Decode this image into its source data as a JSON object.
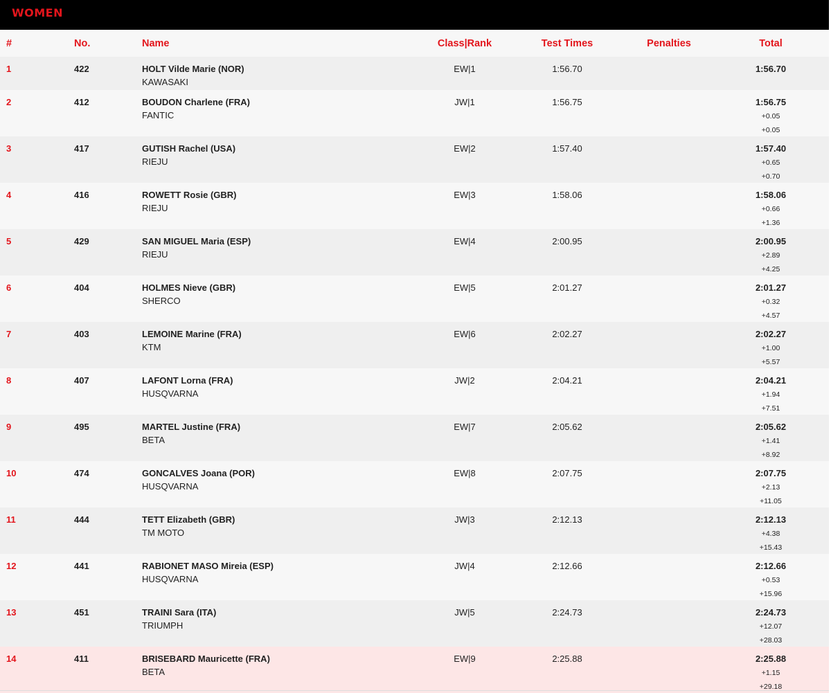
{
  "banner": {
    "title": "WOMEN"
  },
  "header": {
    "pos": "#",
    "num": "No.",
    "name": "Name",
    "class_rank": "Class|Rank",
    "test_times": "Test Times",
    "penalties": "Penalties",
    "total": "Total"
  },
  "colors": {
    "accent": "#e3151c",
    "banner_bg": "#000000",
    "highlight_row": "#fde6e6"
  },
  "rows": [
    {
      "pos": "1",
      "num": "422",
      "name": "HOLT Vilde Marie (NOR)",
      "brand": "KAWASAKI",
      "class_rank": "EW|1",
      "test_time": "1:56.70",
      "penalties": "",
      "total": "1:56.70",
      "gap_prev": "",
      "gap_first": ""
    },
    {
      "pos": "2",
      "num": "412",
      "name": "BOUDON Charlene (FRA)",
      "brand": "FANTIC",
      "class_rank": "JW|1",
      "test_time": "1:56.75",
      "penalties": "",
      "total": "1:56.75",
      "gap_prev": "+0.05",
      "gap_first": "+0.05"
    },
    {
      "pos": "3",
      "num": "417",
      "name": "GUTISH Rachel (USA)",
      "brand": "RIEJU",
      "class_rank": "EW|2",
      "test_time": "1:57.40",
      "penalties": "",
      "total": "1:57.40",
      "gap_prev": "+0.65",
      "gap_first": "+0.70"
    },
    {
      "pos": "4",
      "num": "416",
      "name": "ROWETT Rosie (GBR)",
      "brand": "RIEJU",
      "class_rank": "EW|3",
      "test_time": "1:58.06",
      "penalties": "",
      "total": "1:58.06",
      "gap_prev": "+0.66",
      "gap_first": "+1.36"
    },
    {
      "pos": "5",
      "num": "429",
      "name": "SAN MIGUEL Maria (ESP)",
      "brand": "RIEJU",
      "class_rank": "EW|4",
      "test_time": "2:00.95",
      "penalties": "",
      "total": "2:00.95",
      "gap_prev": "+2.89",
      "gap_first": "+4.25"
    },
    {
      "pos": "6",
      "num": "404",
      "name": "HOLMES Nieve (GBR)",
      "brand": "SHERCO",
      "class_rank": "EW|5",
      "test_time": "2:01.27",
      "penalties": "",
      "total": "2:01.27",
      "gap_prev": "+0.32",
      "gap_first": "+4.57"
    },
    {
      "pos": "7",
      "num": "403",
      "name": "LEMOINE Marine (FRA)",
      "brand": "KTM",
      "class_rank": "EW|6",
      "test_time": "2:02.27",
      "penalties": "",
      "total": "2:02.27",
      "gap_prev": "+1.00",
      "gap_first": "+5.57"
    },
    {
      "pos": "8",
      "num": "407",
      "name": "LAFONT Lorna (FRA)",
      "brand": "HUSQVARNA",
      "class_rank": "JW|2",
      "test_time": "2:04.21",
      "penalties": "",
      "total": "2:04.21",
      "gap_prev": "+1.94",
      "gap_first": "+7.51"
    },
    {
      "pos": "9",
      "num": "495",
      "name": "MARTEL Justine (FRA)",
      "brand": "BETA",
      "class_rank": "EW|7",
      "test_time": "2:05.62",
      "penalties": "",
      "total": "2:05.62",
      "gap_prev": "+1.41",
      "gap_first": "+8.92"
    },
    {
      "pos": "10",
      "num": "474",
      "name": "GONCALVES Joana (POR)",
      "brand": "HUSQVARNA",
      "class_rank": "EW|8",
      "test_time": "2:07.75",
      "penalties": "",
      "total": "2:07.75",
      "gap_prev": "+2.13",
      "gap_first": "+11.05"
    },
    {
      "pos": "11",
      "num": "444",
      "name": "TETT Elizabeth (GBR)",
      "brand": "TM MOTO",
      "class_rank": "JW|3",
      "test_time": "2:12.13",
      "penalties": "",
      "total": "2:12.13",
      "gap_prev": "+4.38",
      "gap_first": "+15.43"
    },
    {
      "pos": "12",
      "num": "441",
      "name": "RABIONET MASO Mireia (ESP)",
      "brand": "HUSQVARNA",
      "class_rank": "JW|4",
      "test_time": "2:12.66",
      "penalties": "",
      "total": "2:12.66",
      "gap_prev": "+0.53",
      "gap_first": "+15.96"
    },
    {
      "pos": "13",
      "num": "451",
      "name": "TRAINI Sara (ITA)",
      "brand": "TRIUMPH",
      "class_rank": "JW|5",
      "test_time": "2:24.73",
      "penalties": "",
      "total": "2:24.73",
      "gap_prev": "+12.07",
      "gap_first": "+28.03"
    },
    {
      "pos": "14",
      "num": "411",
      "name": "BRISEBARD Mauricette (FRA)",
      "brand": "BETA",
      "class_rank": "EW|9",
      "test_time": "2:25.88",
      "penalties": "",
      "total": "2:25.88",
      "gap_prev": "+1.15",
      "gap_first": "+29.18",
      "highlighted": true
    }
  ]
}
